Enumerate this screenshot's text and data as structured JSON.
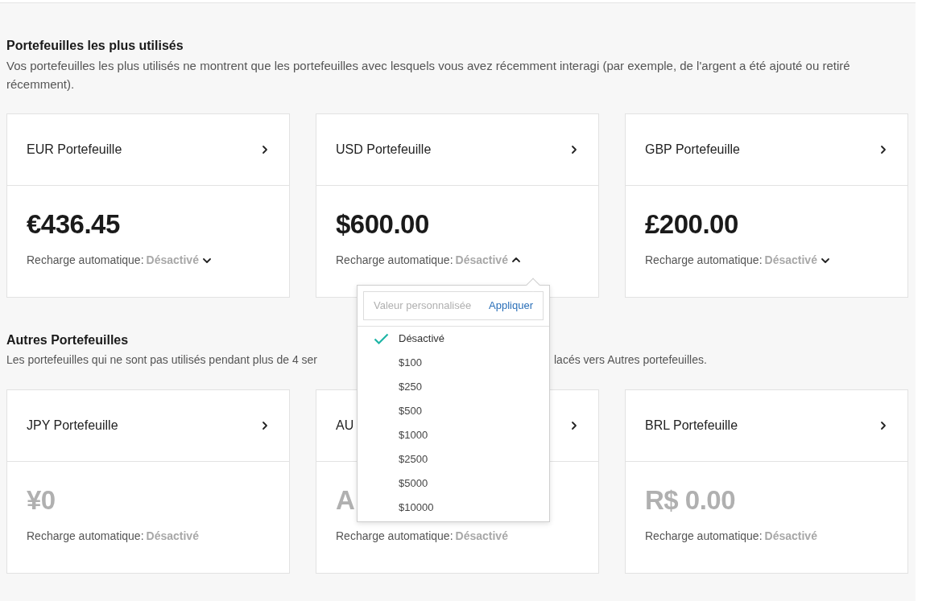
{
  "sections": [
    {
      "title": "Portefeuilles les plus utilisés",
      "description_parts": [
        "Vos portefeuilles les plus utilisés ne montrent que les portefeuilles avec lesquels vous avez récemment interagi (par exemple, de l'argent a été ajouté ou retiré récemment)."
      ],
      "wallets": [
        {
          "name": "EUR Portefeuille",
          "amount": "€436.45",
          "dimmed": false,
          "recharge_label": "Recharge automatique:",
          "recharge_value": "Désactivé",
          "expanded": false
        },
        {
          "name": "USD Portefeuille",
          "amount": "$600.00",
          "dimmed": false,
          "recharge_label": "Recharge automatique:",
          "recharge_value": "Désactivé",
          "expanded": true
        },
        {
          "name": "GBP Portefeuille",
          "amount": "£200.00",
          "dimmed": false,
          "recharge_label": "Recharge automatique:",
          "recharge_value": "Désactivé",
          "expanded": false
        }
      ]
    },
    {
      "title": "Autres Portefeuilles",
      "description_parts": [
        "Les portefeuilles qui ne sont pas utilisés pendant plus de 4 ser",
        "lacés vers Autres portefeuilles."
      ],
      "wallets": [
        {
          "name": "JPY Portefeuille",
          "amount": "¥0",
          "dimmed": true,
          "recharge_label": "Recharge automatique:",
          "recharge_value": "Désactivé"
        },
        {
          "name": "AU",
          "amount": "A",
          "dimmed": true,
          "recharge_label": "Recharge automatique:",
          "recharge_value": "Désactivé"
        },
        {
          "name": "BRL Portefeuille",
          "amount": "R$ 0.00",
          "dimmed": true,
          "recharge_label": "Recharge automatique:",
          "recharge_value": "Désactivé"
        }
      ]
    }
  ],
  "dropdown": {
    "placeholder": "Valeur personnalisée",
    "apply": "Appliquer",
    "options": [
      {
        "label": "Désactivé",
        "selected": true
      },
      {
        "label": "$100",
        "selected": false
      },
      {
        "label": "$250",
        "selected": false
      },
      {
        "label": "$500",
        "selected": false
      },
      {
        "label": "$1000",
        "selected": false
      },
      {
        "label": "$2500",
        "selected": false
      },
      {
        "label": "$5000",
        "selected": false
      },
      {
        "label": "$10000",
        "selected": false
      }
    ]
  }
}
